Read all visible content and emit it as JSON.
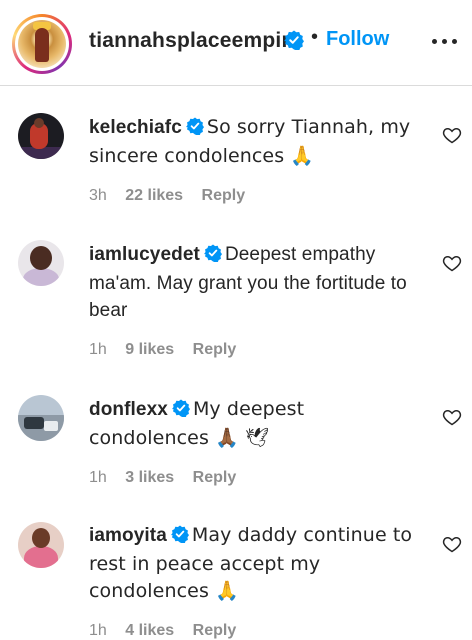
{
  "header": {
    "username": "tiannahsplaceempire",
    "separator": "•",
    "follow_label": "Follow"
  },
  "comments": [
    {
      "username": "kelechiafc",
      "text": "So sorry Tiannah, my sincere condolences 🙏",
      "time": "3h",
      "likes": "22 likes",
      "reply": "Reply"
    },
    {
      "username": "iamlucyedet",
      "text": "Deepest empathy ma'am. May grant you the fortitude to bear",
      "time": "1h",
      "likes": "9 likes",
      "reply": "Reply"
    },
    {
      "username": "donflexx",
      "text": "My deepest condolences 🙏🏾 🕊",
      "time": "1h",
      "likes": "3 likes",
      "reply": "Reply"
    },
    {
      "username": "iamoyita",
      "text": "May daddy continue to rest in peace accept my condolences 🙏",
      "time": "1h",
      "likes": "4 likes",
      "reply": "Reply"
    }
  ],
  "colors": {
    "accent": "#0095f6",
    "text": "#262626",
    "muted": "#8e8e8e"
  }
}
